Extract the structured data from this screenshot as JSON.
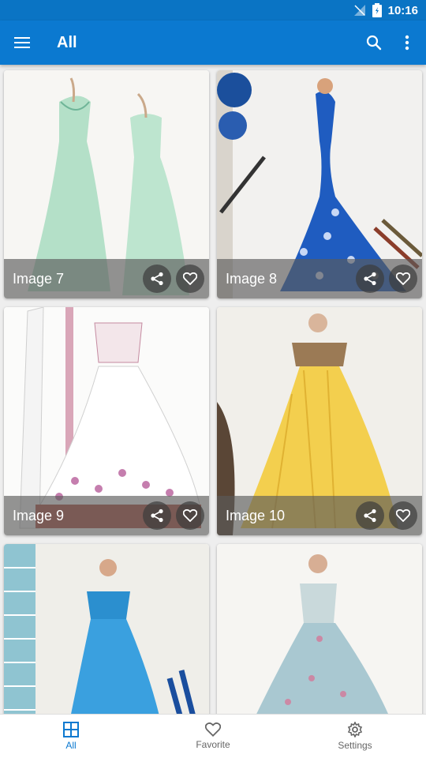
{
  "status_bar": {
    "time": "10:16"
  },
  "app_bar": {
    "title": "All"
  },
  "cards": [
    {
      "label": "Image 7"
    },
    {
      "label": "Image 8"
    },
    {
      "label": "Image 9"
    },
    {
      "label": "Image 10"
    },
    {
      "label": ""
    },
    {
      "label": ""
    }
  ],
  "bottom_nav": {
    "all": "All",
    "favorite": "Favorite",
    "settings": "Settings"
  },
  "colors": {
    "primary": "#0b79d0",
    "status_bar": "#0a74c4"
  },
  "icons": [
    "menu-icon",
    "search-icon",
    "overflow-icon",
    "share-icon",
    "heart-icon",
    "grid-icon",
    "gear-icon"
  ]
}
